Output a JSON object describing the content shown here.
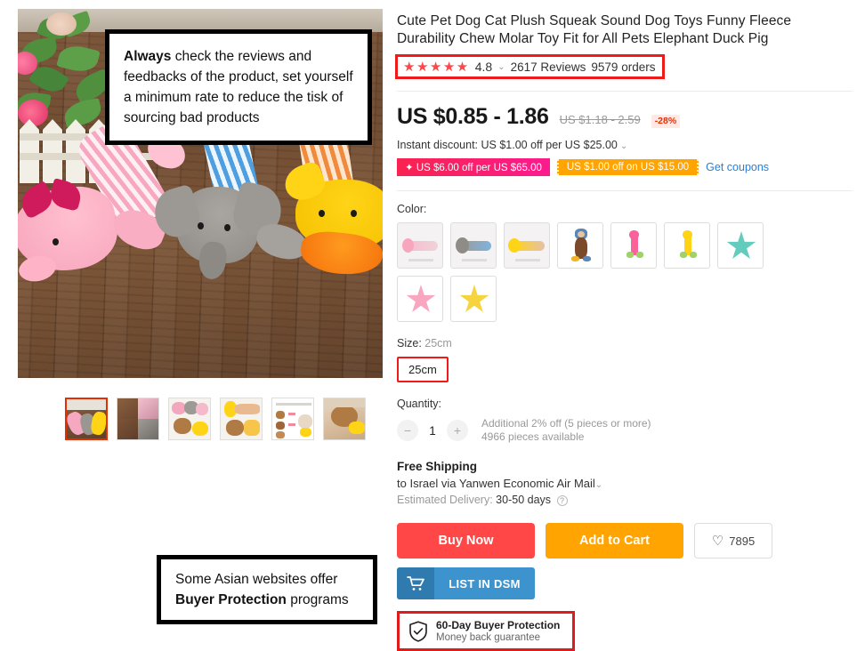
{
  "product": {
    "title": "Cute Pet Dog Cat Plush Squeak Sound Dog Toys Funny Fleece Durability Chew Molar Toy Fit for All Pets Elephant Duck Pig",
    "rating": {
      "stars": "★★★★★",
      "score": "4.8",
      "caret": "⌄",
      "reviews": "2617 Reviews",
      "orders": "9579 orders"
    },
    "price": {
      "current": "US $0.85 - 1.86",
      "original": "US $1.18 - 2.59",
      "discount": "-28%"
    },
    "instant_discount": "Instant discount: US $1.00 off per US $25.00",
    "coupons": [
      {
        "label": "✦ US $6.00 off per US $65.00",
        "style": "pink"
      },
      {
        "label": "US $1.00 off on US $15.00",
        "style": "org"
      }
    ],
    "get_coupons": "Get coupons",
    "color": {
      "label": "Color:",
      "options": [
        {
          "name": "pink-pig-lying"
        },
        {
          "name": "grey-elephant-lying"
        },
        {
          "name": "yellow-duck-lying"
        },
        {
          "name": "brown-monkey-standing"
        },
        {
          "name": "pink-giraffe-standing"
        },
        {
          "name": "yellow-giraffe-standing"
        },
        {
          "name": "teal-starfish"
        },
        {
          "name": "pink-starfish"
        },
        {
          "name": "yellow-starfish"
        }
      ]
    },
    "size": {
      "label": "Size:",
      "selected": "25cm",
      "option": "25cm"
    },
    "quantity": {
      "label": "Quantity:",
      "minus": "−",
      "value": "1",
      "plus": "+",
      "note_line1": "Additional 2% off (5 pieces or more)",
      "note_line2": "4966 pieces available"
    },
    "shipping": {
      "title": "Free Shipping",
      "destination": "to Israel via Yanwen Economic Air Mail",
      "caret": "⌄",
      "eta_label": "Estimated Delivery:",
      "eta_value": "30-50 days",
      "help": "?"
    },
    "actions": {
      "buy_now": "Buy Now",
      "add_to_cart": "Add to Cart",
      "wishlist_heart": "♡",
      "wishlist_count": "7895",
      "dsm_label": "LIST IN DSM"
    },
    "protection": {
      "title": "60-Day Buyer Protection",
      "subtitle": "Money back guarantee"
    },
    "gallery": {
      "thumbnails": [
        {
          "name": "thumb-group-on-wood",
          "selected": true
        },
        {
          "name": "thumb-four-grid"
        },
        {
          "name": "thumb-toys-with-dog"
        },
        {
          "name": "thumb-duck-and-dog"
        },
        {
          "name": "thumb-size-chart"
        },
        {
          "name": "thumb-dog-with-duck"
        }
      ]
    }
  },
  "annotations": {
    "reviews_note": {
      "bold": "Always",
      "rest": " check the reviews and feedbacks of the product, set yourself a minimum rate to reduce the tisk of sourcing bad products"
    },
    "protection_note": {
      "pre": "Some Asian websites offer ",
      "bold": "Buyer Protection",
      "post": " programs"
    }
  },
  "colors": {
    "accent_red": "#ff4747",
    "accent_orange": "#ffa400",
    "link_blue": "#2a7fd4",
    "dsm_blue": "#3d93cd",
    "annotation_border": "#000000",
    "highlight_red": "#ef1b1b"
  }
}
